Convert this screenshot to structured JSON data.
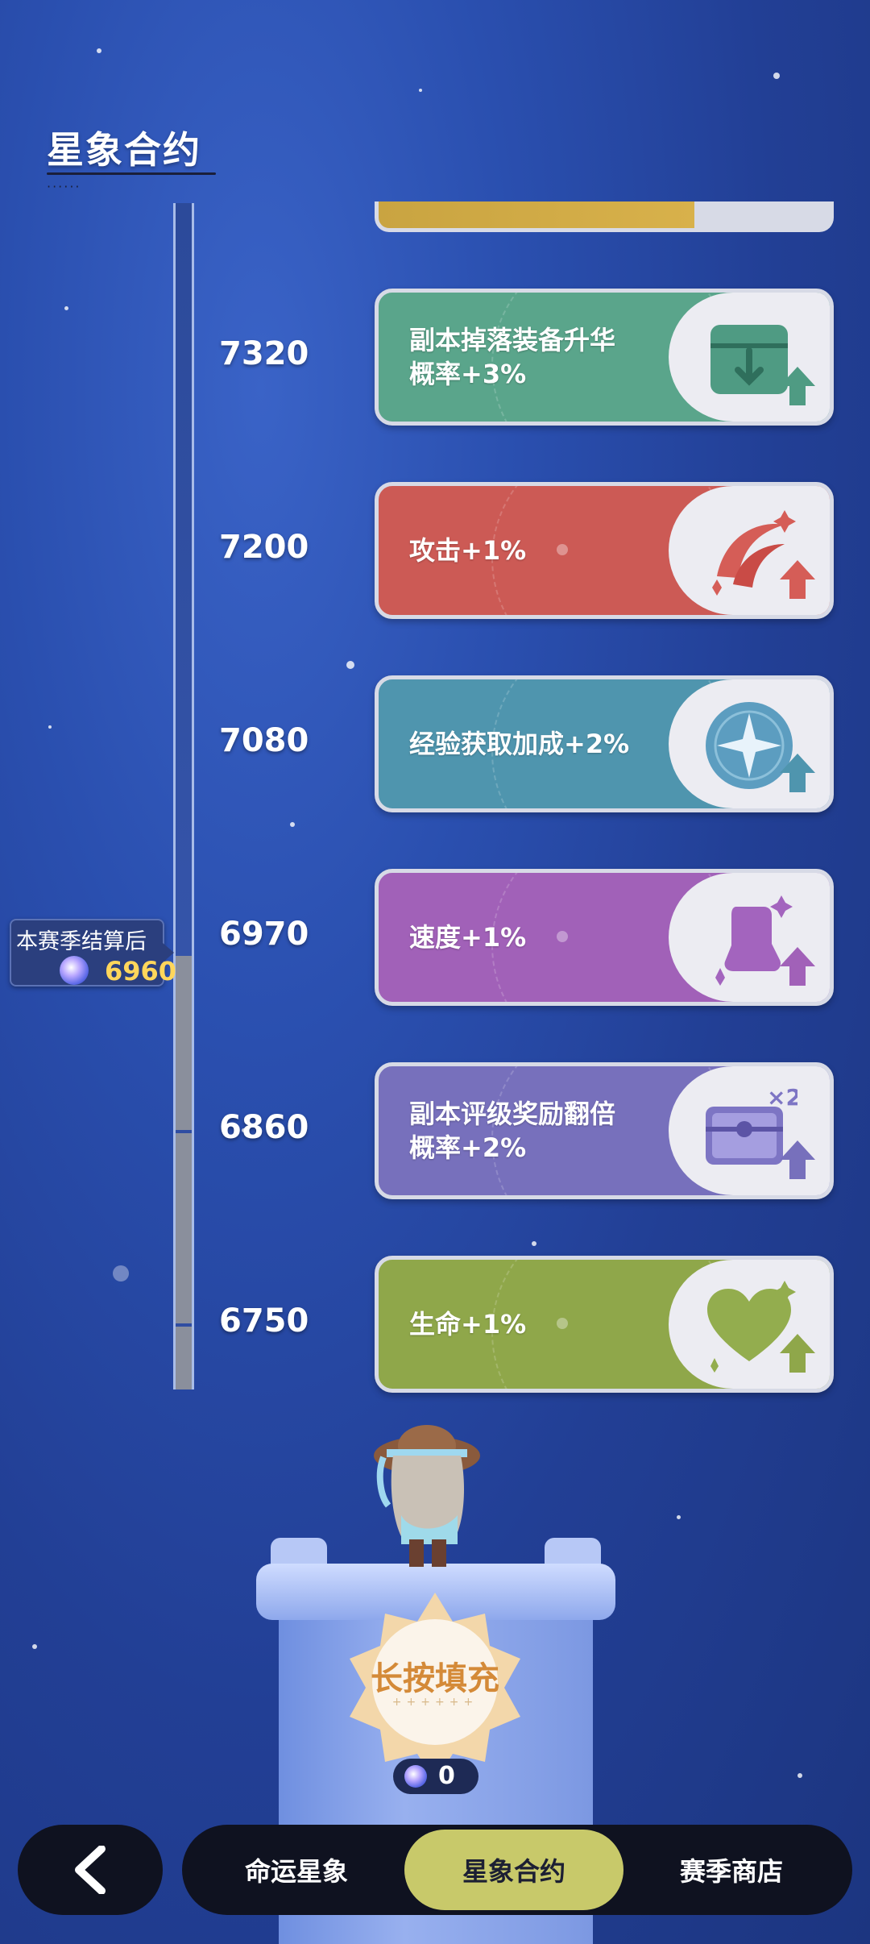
{
  "page_title": "星象合约",
  "marker": {
    "label": "本赛季结算后",
    "value": "6960",
    "icon": "star-crystal-icon"
  },
  "tiers": [
    {
      "value": "7320",
      "reward": "副本掉落装备升华\n概率+3%",
      "color": "#5aa58b",
      "icon": "equipment-box-icon"
    },
    {
      "value": "7200",
      "reward": "攻击+1%",
      "color": "#cc5a55",
      "icon": "attack-slash-icon"
    },
    {
      "value": "7080",
      "reward": "经验获取加成+2%",
      "color": "#4f95ae",
      "icon": "experience-star-icon"
    },
    {
      "value": "6970",
      "reward": "速度+1%",
      "color": "#a161b8",
      "icon": "speed-boot-icon"
    },
    {
      "value": "6860",
      "reward": "副本评级奖励翻倍\n概率+2%",
      "color": "#7770bc",
      "icon": "treasure-chest-x2-icon"
    },
    {
      "value": "6750",
      "reward": "生命+1%",
      "color": "#8fa74a",
      "icon": "heart-icon"
    }
  ],
  "fill_button": {
    "label": "长按填充"
  },
  "cost": {
    "value": "0",
    "icon": "star-crystal-icon"
  },
  "nav": {
    "back_icon": "chevron-left-icon",
    "tabs": [
      {
        "label": "命运星象",
        "active": false
      },
      {
        "label": "星象合约",
        "active": true
      },
      {
        "label": "赛季商店",
        "active": false
      }
    ],
    "active_color": "#c8c96a"
  }
}
